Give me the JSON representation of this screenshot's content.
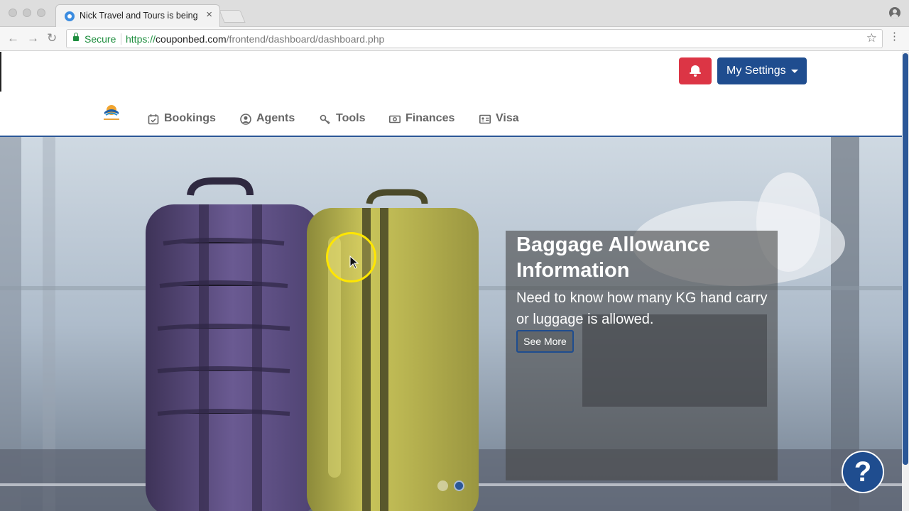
{
  "browser": {
    "tab_title": "Nick Travel and Tours is being",
    "tab_close": "×",
    "secure_label": "Secure",
    "url_scheme": "https://",
    "url_host": "couponbed.com",
    "url_path": "/frontend/dashboard/dashboard.php",
    "back_glyph": "←",
    "forward_glyph": "→",
    "reload_glyph": "↻",
    "bookmark_glyph": "☆",
    "menu_glyph": "⋮"
  },
  "header": {
    "settings_label": "My Settings",
    "bell_icon": "bell-icon",
    "accent_color": "#1f4d8f",
    "alert_color": "#dc3545"
  },
  "nav": {
    "items": [
      {
        "label": "Bookings",
        "icon": "calendar-check-icon"
      },
      {
        "label": "Agents",
        "icon": "user-circle-icon"
      },
      {
        "label": "Tools",
        "icon": "key-icon"
      },
      {
        "label": "Finances",
        "icon": "money-bill-icon"
      },
      {
        "label": "Visa",
        "icon": "id-card-icon"
      }
    ]
  },
  "hero": {
    "title": "Baggage Allowance Information",
    "text": "Need to know how many KG hand carry or luggage is allowed.",
    "button_label": "See More",
    "slide_count": 2,
    "active_slide": 2
  },
  "help": {
    "label": "?"
  }
}
